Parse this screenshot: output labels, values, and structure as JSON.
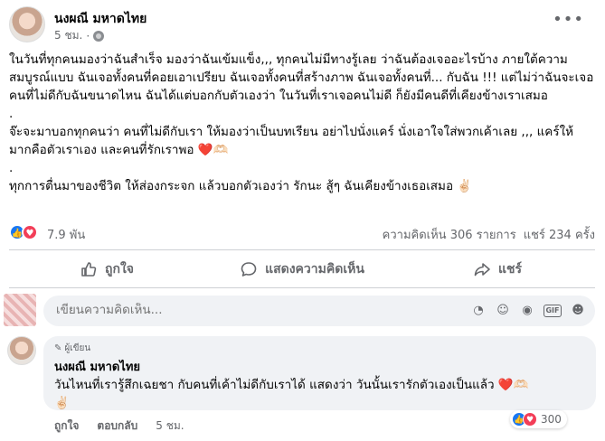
{
  "post": {
    "author": "นงผณี มหาดไทย",
    "time": "5 ชม.",
    "separator": "·",
    "more_icon": "more-horizontal-icon",
    "paragraphs": [
      "ในวันที่ทุกคนมองว่าฉันสำเร็จ มองว่าฉันเข้มแข็ง,,, ทุกคนไม่มีทางรู้เลย ว่าฉันต้องเจออะไรบ้าง ภายใต้ความสมบูรณ์แบบ ฉันเจอทั้งคนที่คอยเอาเปรียบ ฉันเจอทั้งคนที่สร้างภาพ ฉันเจอทั้งคนที่... กับฉัน !!! แต่ไม่ว่าฉันจะเจอคนที่ไม่ดีกับฉันขนาดไหน ฉันได้แต่บอกกับตัวเองว่า ในวันที่เราเจอคนไม่ดี ก็ยังมีคนดีที่เคียงข้างเราเสมอ",
      ".",
      "  จ๊ะจะมาบอกทุกคนว่า คนที่ไม่ดีกับเรา ให้มองว่าเป็นบทเรียน อย่าไปนั่งแคร์ นั่งเอาใจใส่พวกเค้าเลย ,,, แคร์ให้มากคือตัวเราเอง และคนที่รักเราพอ ❤️🫶🏻",
      ".",
      "  ทุกการตื่นมาของชีวิต ให้ส่องกระจก แล้วบอกตัวเองว่า รักนะ สู้ๆ ฉันเคียงข้างเธอเสมอ ✌🏻"
    ]
  },
  "stats": {
    "reactions": "7.9 พัน",
    "comments": "ความคิดเห็น 306 รายการ",
    "shares": "แชร์ 234 ครั้ง"
  },
  "actions": {
    "like": "ถูกใจ",
    "comment": "แสดงความคิดเห็น",
    "share": "แชร์"
  },
  "composer": {
    "placeholder": "เขียนความคิดเห็น...",
    "tools": [
      "sticker-icon",
      "emoji-icon",
      "camera-icon",
      "gif-icon",
      "smiley-sticker-icon"
    ],
    "gif_label": "GIF"
  },
  "comment": {
    "badge": "ผู้เขียน",
    "author": "นงผณี มหาดไทย",
    "text_line1": "วันไหนที่เรารู้สึกเฉยชา กับคนที่เค้าไม่ดีกับเราได้ แสดงว่า วันนั้นเรารักตัวเองเป็นแล้ว ❤️🫶🏻",
    "text_line2": "✌🏻",
    "like": "ถูกใจ",
    "reply": "ตอบกลับ",
    "time": "5 ชม.",
    "reaction_count": "300"
  },
  "colors": {
    "accent": "#1877f2",
    "love": "#f33e58",
    "muted": "#65676b",
    "bubble": "#f0f2f5"
  }
}
